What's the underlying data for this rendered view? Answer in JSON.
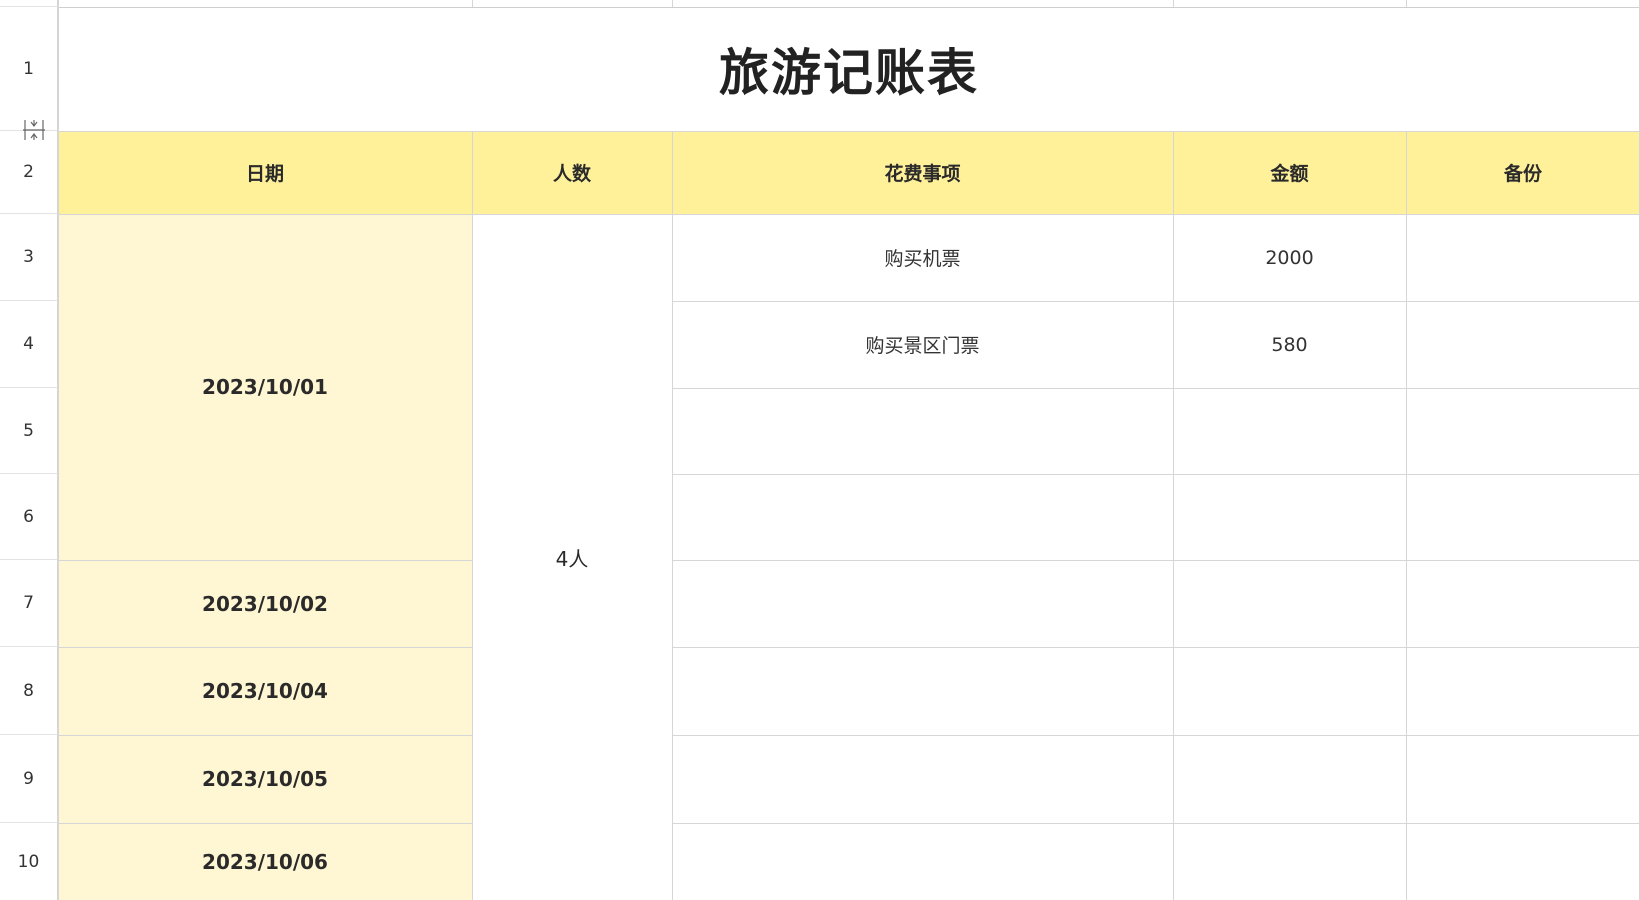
{
  "sheet": {
    "title": "旅游记账表",
    "row_numbers": [
      "1",
      "2",
      "3",
      "4",
      "5",
      "6",
      "7",
      "8",
      "9",
      "10"
    ],
    "headers": {
      "date": "日期",
      "people": "人数",
      "expense_item": "花费事项",
      "amount": "金额",
      "backup": "备份"
    },
    "dates": [
      "2023/10/01",
      "2023/10/02",
      "2023/10/04",
      "2023/10/05",
      "2023/10/06"
    ],
    "people_count": "4人",
    "rows": [
      {
        "item": "购买机票",
        "amount": "2000",
        "backup": ""
      },
      {
        "item": "购买景区门票",
        "amount": "580",
        "backup": ""
      },
      {
        "item": "",
        "amount": "",
        "backup": ""
      },
      {
        "item": "",
        "amount": "",
        "backup": ""
      },
      {
        "item": "",
        "amount": "",
        "backup": ""
      },
      {
        "item": "",
        "amount": "",
        "backup": ""
      },
      {
        "item": "",
        "amount": "",
        "backup": ""
      },
      {
        "item": "",
        "amount": "",
        "backup": ""
      }
    ],
    "colors": {
      "header_fill": "#fff09a",
      "date_fill": "#fff7d3",
      "gridline": "#d6d6d6"
    },
    "icons": {
      "row_resize": "row-resize-icon"
    }
  }
}
